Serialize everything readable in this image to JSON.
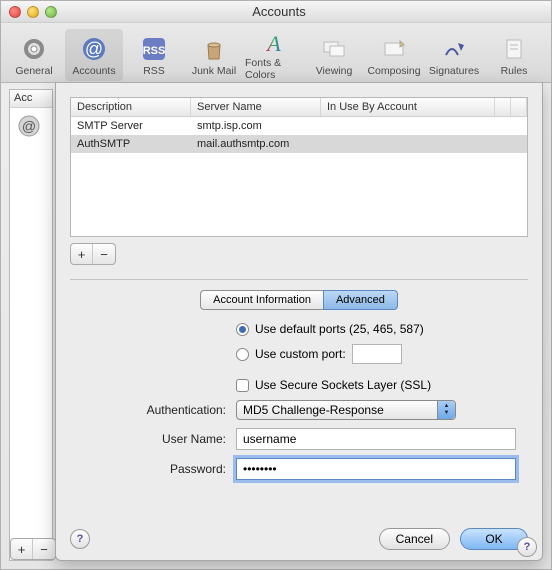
{
  "window": {
    "title": "Accounts"
  },
  "toolbar": {
    "items": [
      {
        "label": "General",
        "icon": "gear"
      },
      {
        "label": "Accounts",
        "icon": "at",
        "selected": true
      },
      {
        "label": "RSS",
        "icon": "rss"
      },
      {
        "label": "Junk Mail",
        "icon": "trash"
      },
      {
        "label": "Fonts & Colors",
        "icon": "fonts"
      },
      {
        "label": "Viewing",
        "icon": "viewing"
      },
      {
        "label": "Composing",
        "icon": "composing"
      },
      {
        "label": "Signatures",
        "icon": "signatures"
      },
      {
        "label": "Rules",
        "icon": "rules"
      }
    ]
  },
  "accounts_list": {
    "header": "Acc"
  },
  "table": {
    "headers": [
      "Description",
      "Server Name",
      "In Use By Account"
    ],
    "rows": [
      {
        "desc": "SMTP Server",
        "server": "smtp.isp.com",
        "inuse": ""
      },
      {
        "desc": "AuthSMTP",
        "server": "mail.authsmtp.com",
        "inuse": "",
        "selected": true
      }
    ]
  },
  "tabs": {
    "info": "Account Information",
    "advanced": "Advanced"
  },
  "form": {
    "default_ports_label": "Use default ports (25, 465, 587)",
    "custom_port_label": "Use custom port:",
    "ssl_label": "Use Secure Sockets Layer (SSL)",
    "auth_label": "Authentication:",
    "auth_value": "MD5 Challenge-Response",
    "user_label": "User Name:",
    "user_value": "username",
    "pass_label": "Password:",
    "pass_value": "••••••••"
  },
  "buttons": {
    "cancel": "Cancel",
    "ok": "OK"
  },
  "glyphs": {
    "plus": "+",
    "minus": "−",
    "help": "?"
  }
}
